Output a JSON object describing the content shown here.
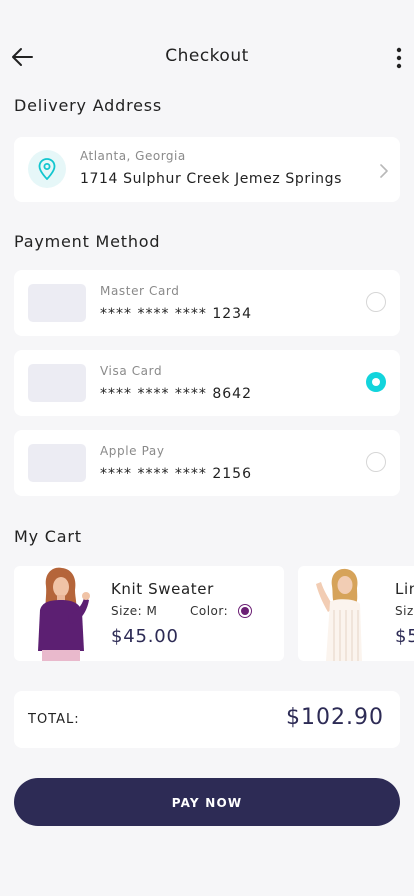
{
  "header": {
    "title": "Checkout",
    "back_icon": "arrow-left-icon",
    "menu_icon": "more-vertical-icon"
  },
  "delivery": {
    "section_title": "Delivery Address",
    "city": "Atlanta, Georgia",
    "street": "1714 Sulphur Creek Jemez Springs",
    "icon": "location-pin-icon",
    "accent_color": "#12d4dc"
  },
  "payment": {
    "section_title": "Payment Method",
    "methods": [
      {
        "name": "Master Card",
        "number": "**** **** **** 1234",
        "selected": false
      },
      {
        "name": "Visa Card",
        "number": "**** **** **** 8642",
        "selected": true
      },
      {
        "name": "Apple Pay",
        "number": "**** **** **** 2156",
        "selected": false
      }
    ]
  },
  "cart": {
    "section_title": "My Cart",
    "items": [
      {
        "name": "Knit Sweater",
        "size_label": "Size: M",
        "color_label": "Color:",
        "color": "#6b1f74",
        "price": "$45.00"
      },
      {
        "name": "Lin",
        "size_label": "Siz",
        "price": "$5"
      }
    ]
  },
  "summary": {
    "total_label": "TOTAL:",
    "total_value": "$102.90"
  },
  "actions": {
    "pay_label": "PAY NOW",
    "button_color": "#2d2b55"
  }
}
